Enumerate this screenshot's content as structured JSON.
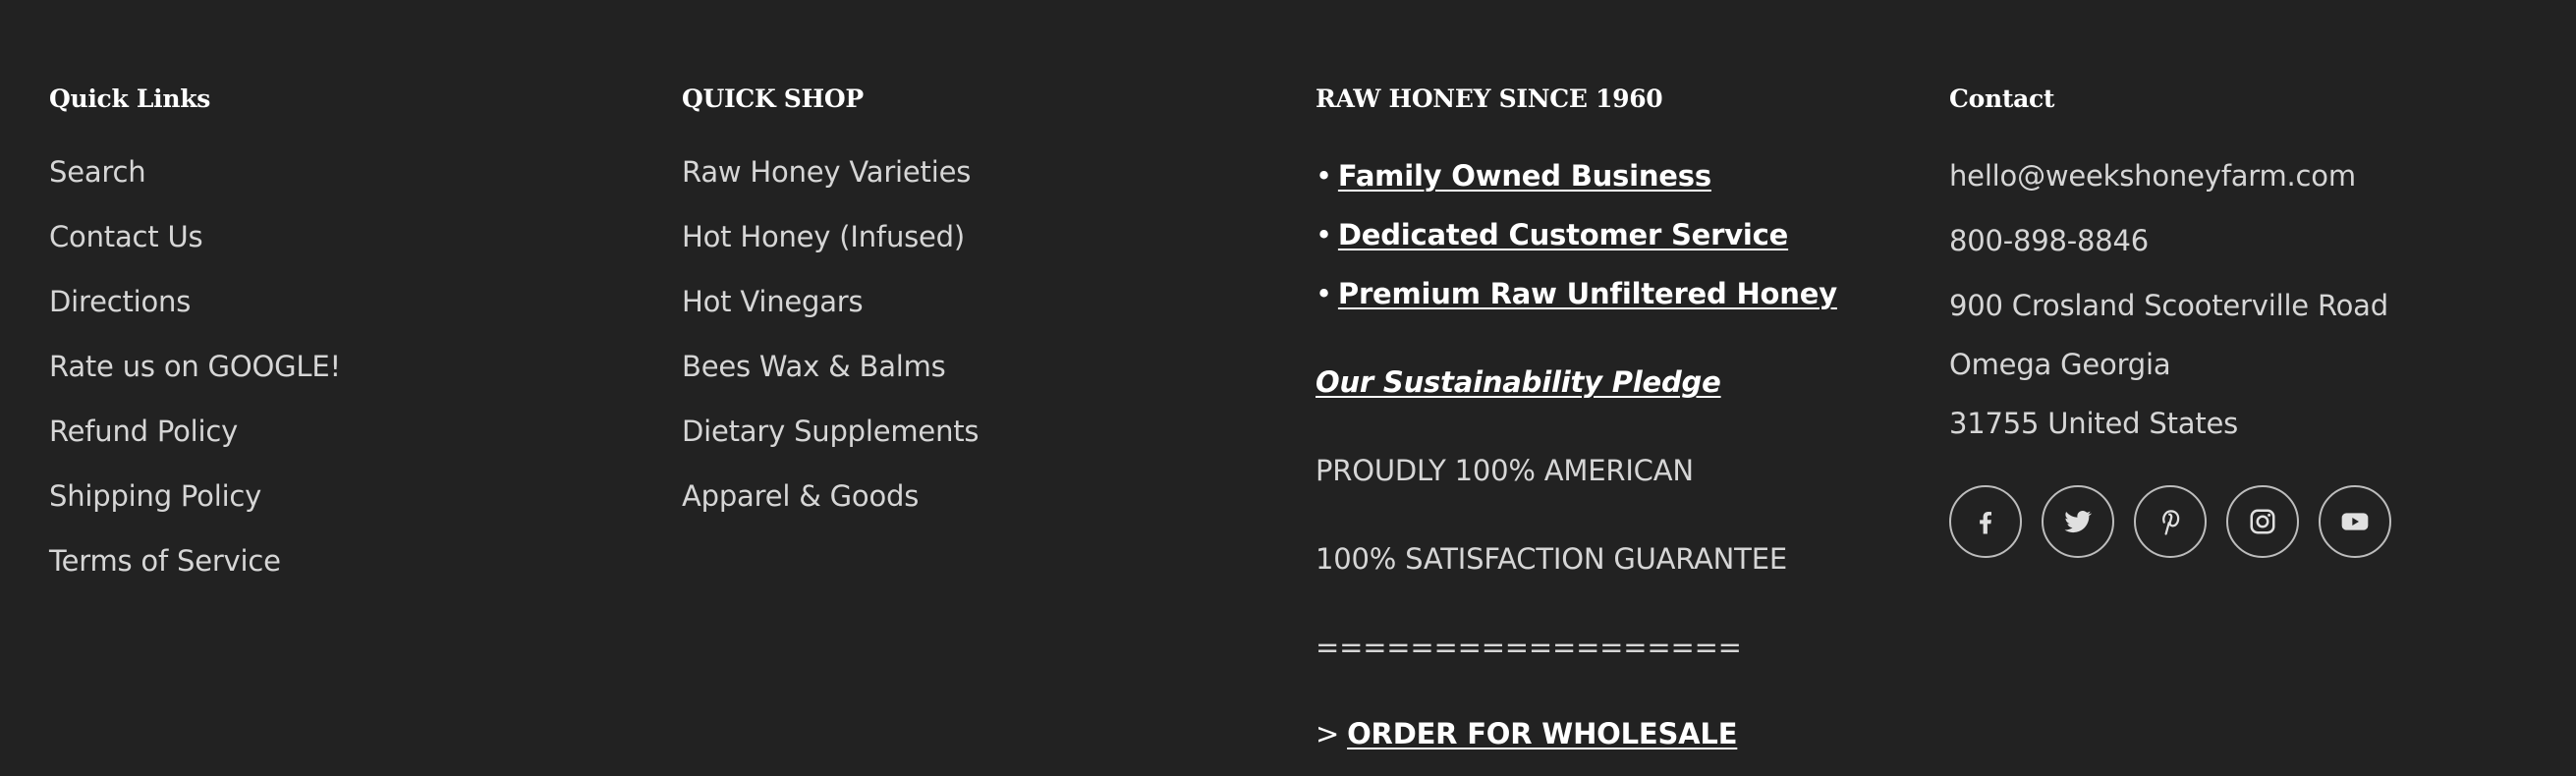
{
  "columns": {
    "quick_links": {
      "title": "Quick Links",
      "items": [
        "Search",
        "Contact Us",
        "Directions",
        "Rate us on GOOGLE!",
        "Refund Policy",
        "Shipping Policy",
        "Terms of Service"
      ]
    },
    "quick_shop": {
      "title": "QUICK SHOP",
      "items": [
        "Raw Honey Varieties",
        "Hot Honey (Infused)",
        "Hot Vinegars",
        "Bees Wax & Balms",
        "Dietary Supplements",
        "Apparel & Goods"
      ]
    },
    "about": {
      "title": "RAW HONEY SINCE 1960",
      "bullet_char": "•",
      "bullets": [
        "Family Owned Business",
        "Dedicated Customer Service",
        "Premium Raw Unfiltered Honey"
      ],
      "pledge": "Our Sustainability Pledge",
      "american": "PROUDLY 100% AMERICAN",
      "guarantee": "100% SATISFACTION GUARANTEE",
      "divider": "==================",
      "wholesale_prefix": ">",
      "wholesale": "ORDER FOR WHOLESALE"
    },
    "contact": {
      "title": "Contact",
      "email": "hello@weekshoneyfarm.com",
      "phone": "800-898-8846",
      "address_line1": "900 Crosland Scooterville Road",
      "address_line2": "Omega Georgia",
      "address_line3": "31755 United States",
      "social_icons": [
        "facebook-icon",
        "twitter-icon",
        "pinterest-icon",
        "instagram-icon",
        "youtube-icon"
      ]
    }
  },
  "colors": {
    "background": "#222222",
    "heading": "#ffffff",
    "text": "#d6d6d6",
    "icon_border": "#bdbdbd"
  }
}
